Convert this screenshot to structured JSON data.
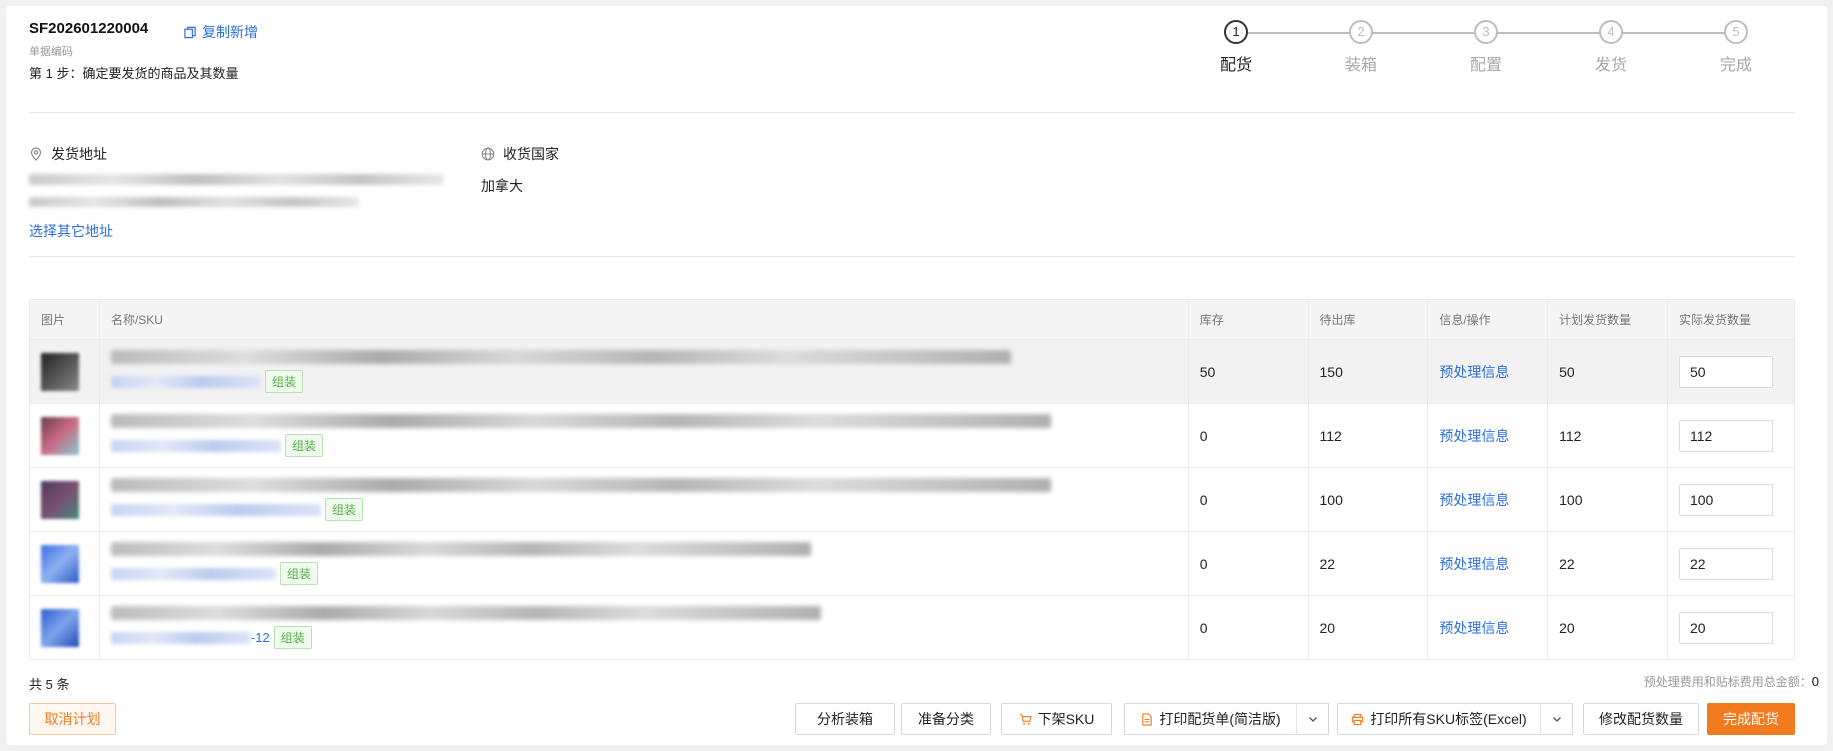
{
  "header": {
    "doc_no": "SF202601220004",
    "copy_label": "复制新增",
    "doc_label": "单据编码",
    "step_title": "第 1 步：确定要发货的商品及其数量"
  },
  "steps": [
    {
      "num": "1",
      "label": "配货",
      "active": true
    },
    {
      "num": "2",
      "label": "装箱",
      "active": false
    },
    {
      "num": "3",
      "label": "配置",
      "active": false
    },
    {
      "num": "4",
      "label": "发货",
      "active": false
    },
    {
      "num": "5",
      "label": "完成",
      "active": false
    }
  ],
  "address": {
    "ship_from_title": "发货地址",
    "country_title": "收货国家",
    "country_value": "加拿大",
    "choose_other": "选择其它地址"
  },
  "table": {
    "headers": [
      "图片",
      "名称/SKU",
      "库存",
      "待出库",
      "信息/操作",
      "计划发货数量",
      "实际发货数量"
    ],
    "rows": [
      {
        "stock": "50",
        "pending": "150",
        "info": "预处理信息",
        "planned": "50",
        "actual": "50",
        "tag": "组装",
        "sku_suffix": "",
        "thumb_colors": [
          "#222",
          "#555",
          "#888"
        ]
      },
      {
        "stock": "0",
        "pending": "112",
        "info": "预处理信息",
        "planned": "112",
        "actual": "112",
        "tag": "组装",
        "sku_suffix": "",
        "thumb_colors": [
          "#6b3a4a",
          "#c86b85",
          "#86c8d0"
        ]
      },
      {
        "stock": "0",
        "pending": "100",
        "info": "预处理信息",
        "planned": "100",
        "actual": "100",
        "tag": "组装",
        "sku_suffix": "",
        "thumb_colors": [
          "#4a3a5c",
          "#7a4f72",
          "#3f8a7a"
        ]
      },
      {
        "stock": "0",
        "pending": "22",
        "info": "预处理信息",
        "planned": "22",
        "actual": "22",
        "tag": "组装",
        "sku_suffix": "",
        "thumb_colors": [
          "#3a6fe0",
          "#8fb0f0",
          "#2b5ac8"
        ]
      },
      {
        "stock": "0",
        "pending": "20",
        "info": "预处理信息",
        "planned": "20",
        "actual": "20",
        "tag": "组装",
        "sku_suffix": "-12",
        "thumb_colors": [
          "#2f5ecf",
          "#7ea4ec",
          "#1f4ab5"
        ]
      }
    ]
  },
  "footer": {
    "total": "共 5 条",
    "fee_label": "预处理费用和贴标费用总金额：",
    "fee_value": "0"
  },
  "buttons": {
    "cancel": "取消计划",
    "analyze": "分析装箱",
    "prepare": "准备分类",
    "remove_sku": "下架SKU",
    "print_list": "打印配货单(简洁版)",
    "print_labels": "打印所有SKU标签(Excel)",
    "modify_qty": "修改配货数量",
    "complete": "完成配货"
  },
  "colors": {
    "accent": "#f07a1d",
    "link": "#2a6fdb",
    "tag_green": "#52b141"
  }
}
